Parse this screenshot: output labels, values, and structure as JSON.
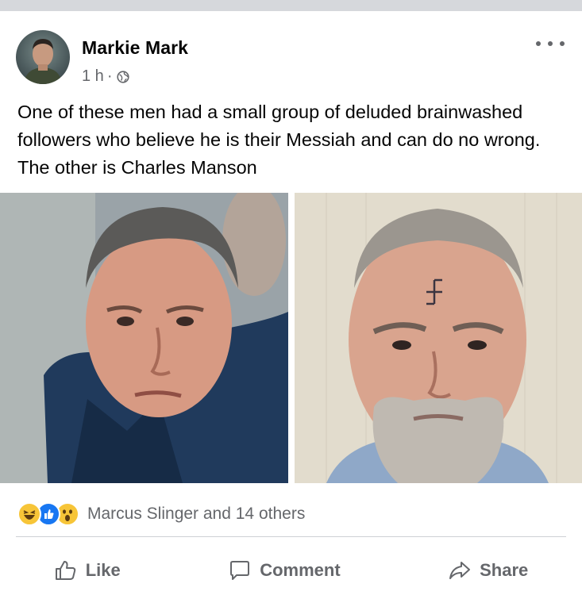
{
  "post": {
    "author": "Markie Mark",
    "time": "1 h",
    "separator": "·",
    "privacy_icon": "globe-icon",
    "more_icon": "more-options-icon",
    "text": "One of these men had a small group of deluded brainwashed followers who believe he is their Messiah and can do no wrong. The other is Charles Manson"
  },
  "photos": [
    {
      "name": "photo-left",
      "description_icon": "man-in-coat-photo"
    },
    {
      "name": "photo-right",
      "description_icon": "bearded-man-mugshot-photo"
    }
  ],
  "reactions": {
    "icons": [
      "haha-reaction-icon",
      "like-reaction-icon",
      "wow-reaction-icon"
    ],
    "summary": "Marcus Slinger and 14 others"
  },
  "actions": {
    "like": "Like",
    "comment": "Comment",
    "share": "Share"
  },
  "colors": {
    "text_primary": "#050505",
    "text_secondary": "#65676b",
    "like_blue": "#1877f2",
    "reaction_yellow": "#f7c538",
    "divider": "#ced0d4"
  }
}
